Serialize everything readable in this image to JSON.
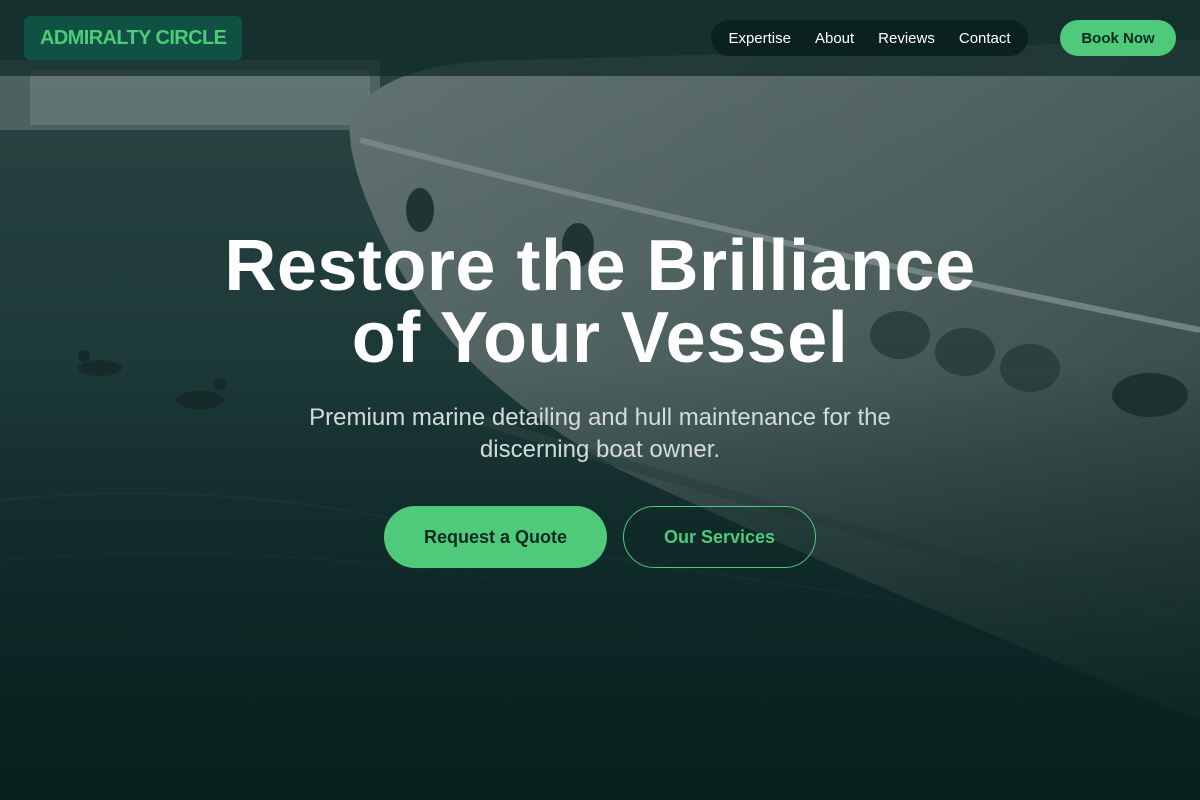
{
  "header": {
    "logo": "ADMIRALTY CIRCLE",
    "nav": [
      {
        "label": "Expertise"
      },
      {
        "label": "About"
      },
      {
        "label": "Reviews"
      },
      {
        "label": "Contact"
      }
    ],
    "cta": "Book Now"
  },
  "hero": {
    "title_line1": "Restore the Brilliance",
    "title_line2": "of Your Vessel",
    "subtitle": "Premium marine detailing and hull maintenance for the discerning boat owner.",
    "primary_button": "Request a Quote",
    "secondary_button": "Our Services"
  },
  "colors": {
    "accent": "#4fc97a",
    "logo_bg": "#0f5142",
    "background": "#0d2623"
  }
}
